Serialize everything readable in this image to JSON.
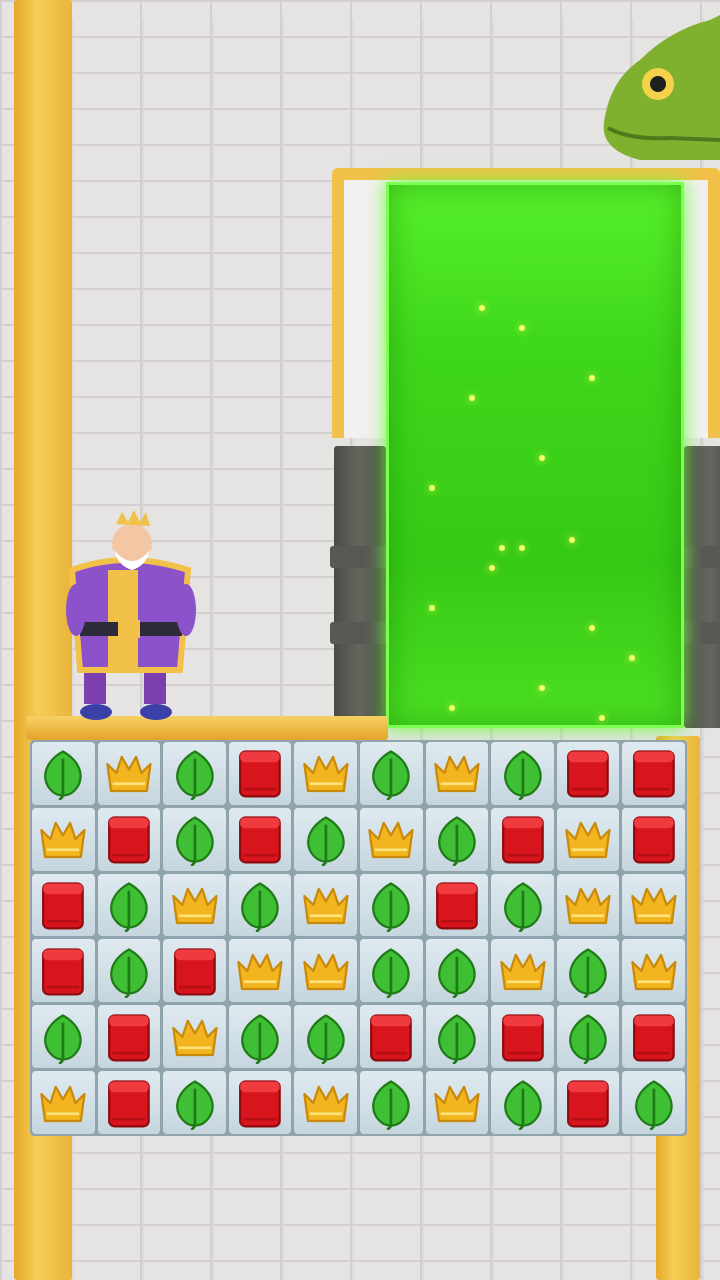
{
  "scene": {
    "colors": {
      "frame_yellow": "#f1c14a",
      "portal_green": "#3fd71b",
      "wall": "#e6e3e3",
      "pillar": "#585952"
    }
  },
  "characters": {
    "king": {
      "icon": "king-icon"
    },
    "snake": {
      "icon": "snake-head-icon"
    }
  },
  "board": {
    "columns": 10,
    "rows": 6,
    "tile_types": {
      "L": {
        "name": "leaf",
        "icon": "leaf-icon",
        "color": "#3fbf33"
      },
      "C": {
        "name": "crown",
        "icon": "crown-icon",
        "color": "#f2b51f"
      },
      "B": {
        "name": "book",
        "icon": "red-box-icon",
        "color": "#d8141c"
      }
    },
    "grid": [
      [
        "L",
        "C",
        "L",
        "B",
        "C",
        "L",
        "C",
        "L",
        "B",
        "B"
      ],
      [
        "C",
        "B",
        "L",
        "B",
        "L",
        "C",
        "L",
        "B",
        "C",
        "B"
      ],
      [
        "B",
        "L",
        "C",
        "L",
        "C",
        "L",
        "B",
        "L",
        "C",
        "C"
      ],
      [
        "B",
        "L",
        "B",
        "C",
        "C",
        "L",
        "L",
        "C",
        "L",
        "C"
      ],
      [
        "L",
        "B",
        "C",
        "L",
        "L",
        "B",
        "L",
        "B",
        "L",
        "B"
      ],
      [
        "C",
        "B",
        "L",
        "B",
        "C",
        "L",
        "C",
        "L",
        "B",
        "L"
      ]
    ]
  }
}
